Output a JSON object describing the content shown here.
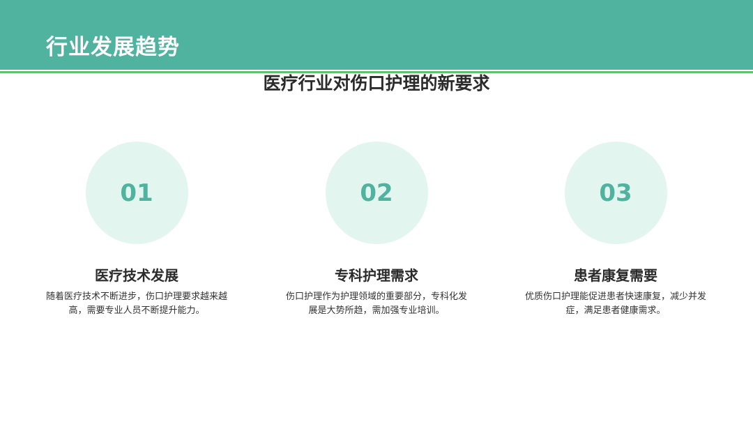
{
  "header": {
    "title": "行业发展趋势"
  },
  "section": {
    "title": "医疗行业对伤口护理的新要求"
  },
  "cards": [
    {
      "number": "01",
      "heading": "医疗技术发展",
      "description": "随着医疗技术不断进步，伤口护理要求越来越高，需要专业人员不断提升能力。"
    },
    {
      "number": "02",
      "heading": "专科护理需求",
      "description": "伤口护理作为护理领域的重要部分，专科化发展是大势所趋，需加强专业培训。"
    },
    {
      "number": "03",
      "heading": "患者康复需要",
      "description": "优质伤口护理能促进患者快速康复，减少并发症，满足患者健康需求。"
    }
  ],
  "colors": {
    "header_band": "#4fb3a0",
    "header_line": "#63c06f",
    "circle_fill": "#e2f5ee",
    "number_text": "#4fb3a0"
  }
}
